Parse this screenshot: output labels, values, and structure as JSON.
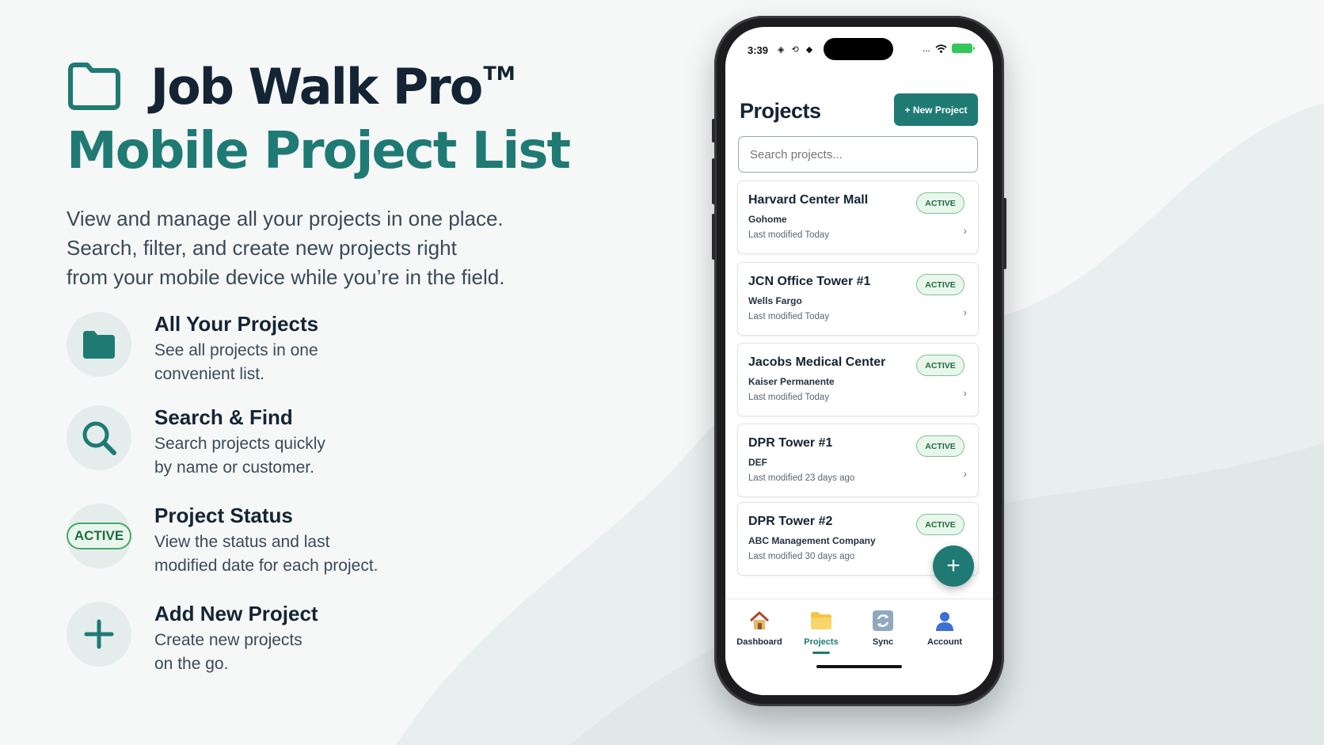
{
  "hero": {
    "title": "Job Walk Pro",
    "trademark": "TM",
    "subtitle": "Mobile Project List",
    "description_lines": [
      "View and manage all your projects in one place.",
      "Search, filter, and create new projects right",
      "from your mobile device while you’re in the field."
    ]
  },
  "features": [
    {
      "icon": "folder-icon",
      "title": "All Your Projects",
      "description": "See all projects in one\nconvenient list."
    },
    {
      "icon": "search-icon",
      "title": "Search & Find",
      "description": "Search projects quickly\nby name or customer."
    },
    {
      "icon": "active-badge",
      "badge": "ACTIVE",
      "title": "Project Status",
      "description": "View the status and last\nmodified date for each project."
    },
    {
      "icon": "plus-icon",
      "title": "Add New Project",
      "description": "Create new projects\non the go."
    }
  ],
  "phone": {
    "status": {
      "time": "3:39",
      "left_icons": "◈ ⟲ ◆",
      "dots": "..."
    },
    "page_title": "Projects",
    "new_project_label": "+ New Project",
    "search_placeholder": "Search projects...",
    "projects": [
      {
        "name": "Harvard Center Mall",
        "customer": "Gohome",
        "modified": "Last modified Today",
        "status": "ACTIVE"
      },
      {
        "name": "JCN Office Tower #1",
        "customer": "Wells Fargo",
        "modified": "Last modified Today",
        "status": "ACTIVE"
      },
      {
        "name": "Jacobs Medical Center",
        "customer": "Kaiser Permanente",
        "modified": "Last modified Today",
        "status": "ACTIVE"
      },
      {
        "name": "DPR Tower #1",
        "customer": "DEF",
        "modified": "Last modified 23 days ago",
        "status": "ACTIVE"
      },
      {
        "name": "DPR Tower #2",
        "customer": "ABC Management Company",
        "modified": "Last modified 30 days ago",
        "status": "ACTIVE"
      }
    ],
    "fab_label": "+",
    "tabs": [
      {
        "label": "Dashboard",
        "icon": "house-icon",
        "active": false
      },
      {
        "label": "Projects",
        "icon": "folder-icon",
        "active": true
      },
      {
        "label": "Sync",
        "icon": "sync-icon",
        "active": false
      },
      {
        "label": "Account",
        "icon": "person-icon",
        "active": false
      }
    ]
  },
  "colors": {
    "brand_teal": "#1f7a74",
    "status_green": "#46a86b",
    "title_dark": "#142435"
  }
}
